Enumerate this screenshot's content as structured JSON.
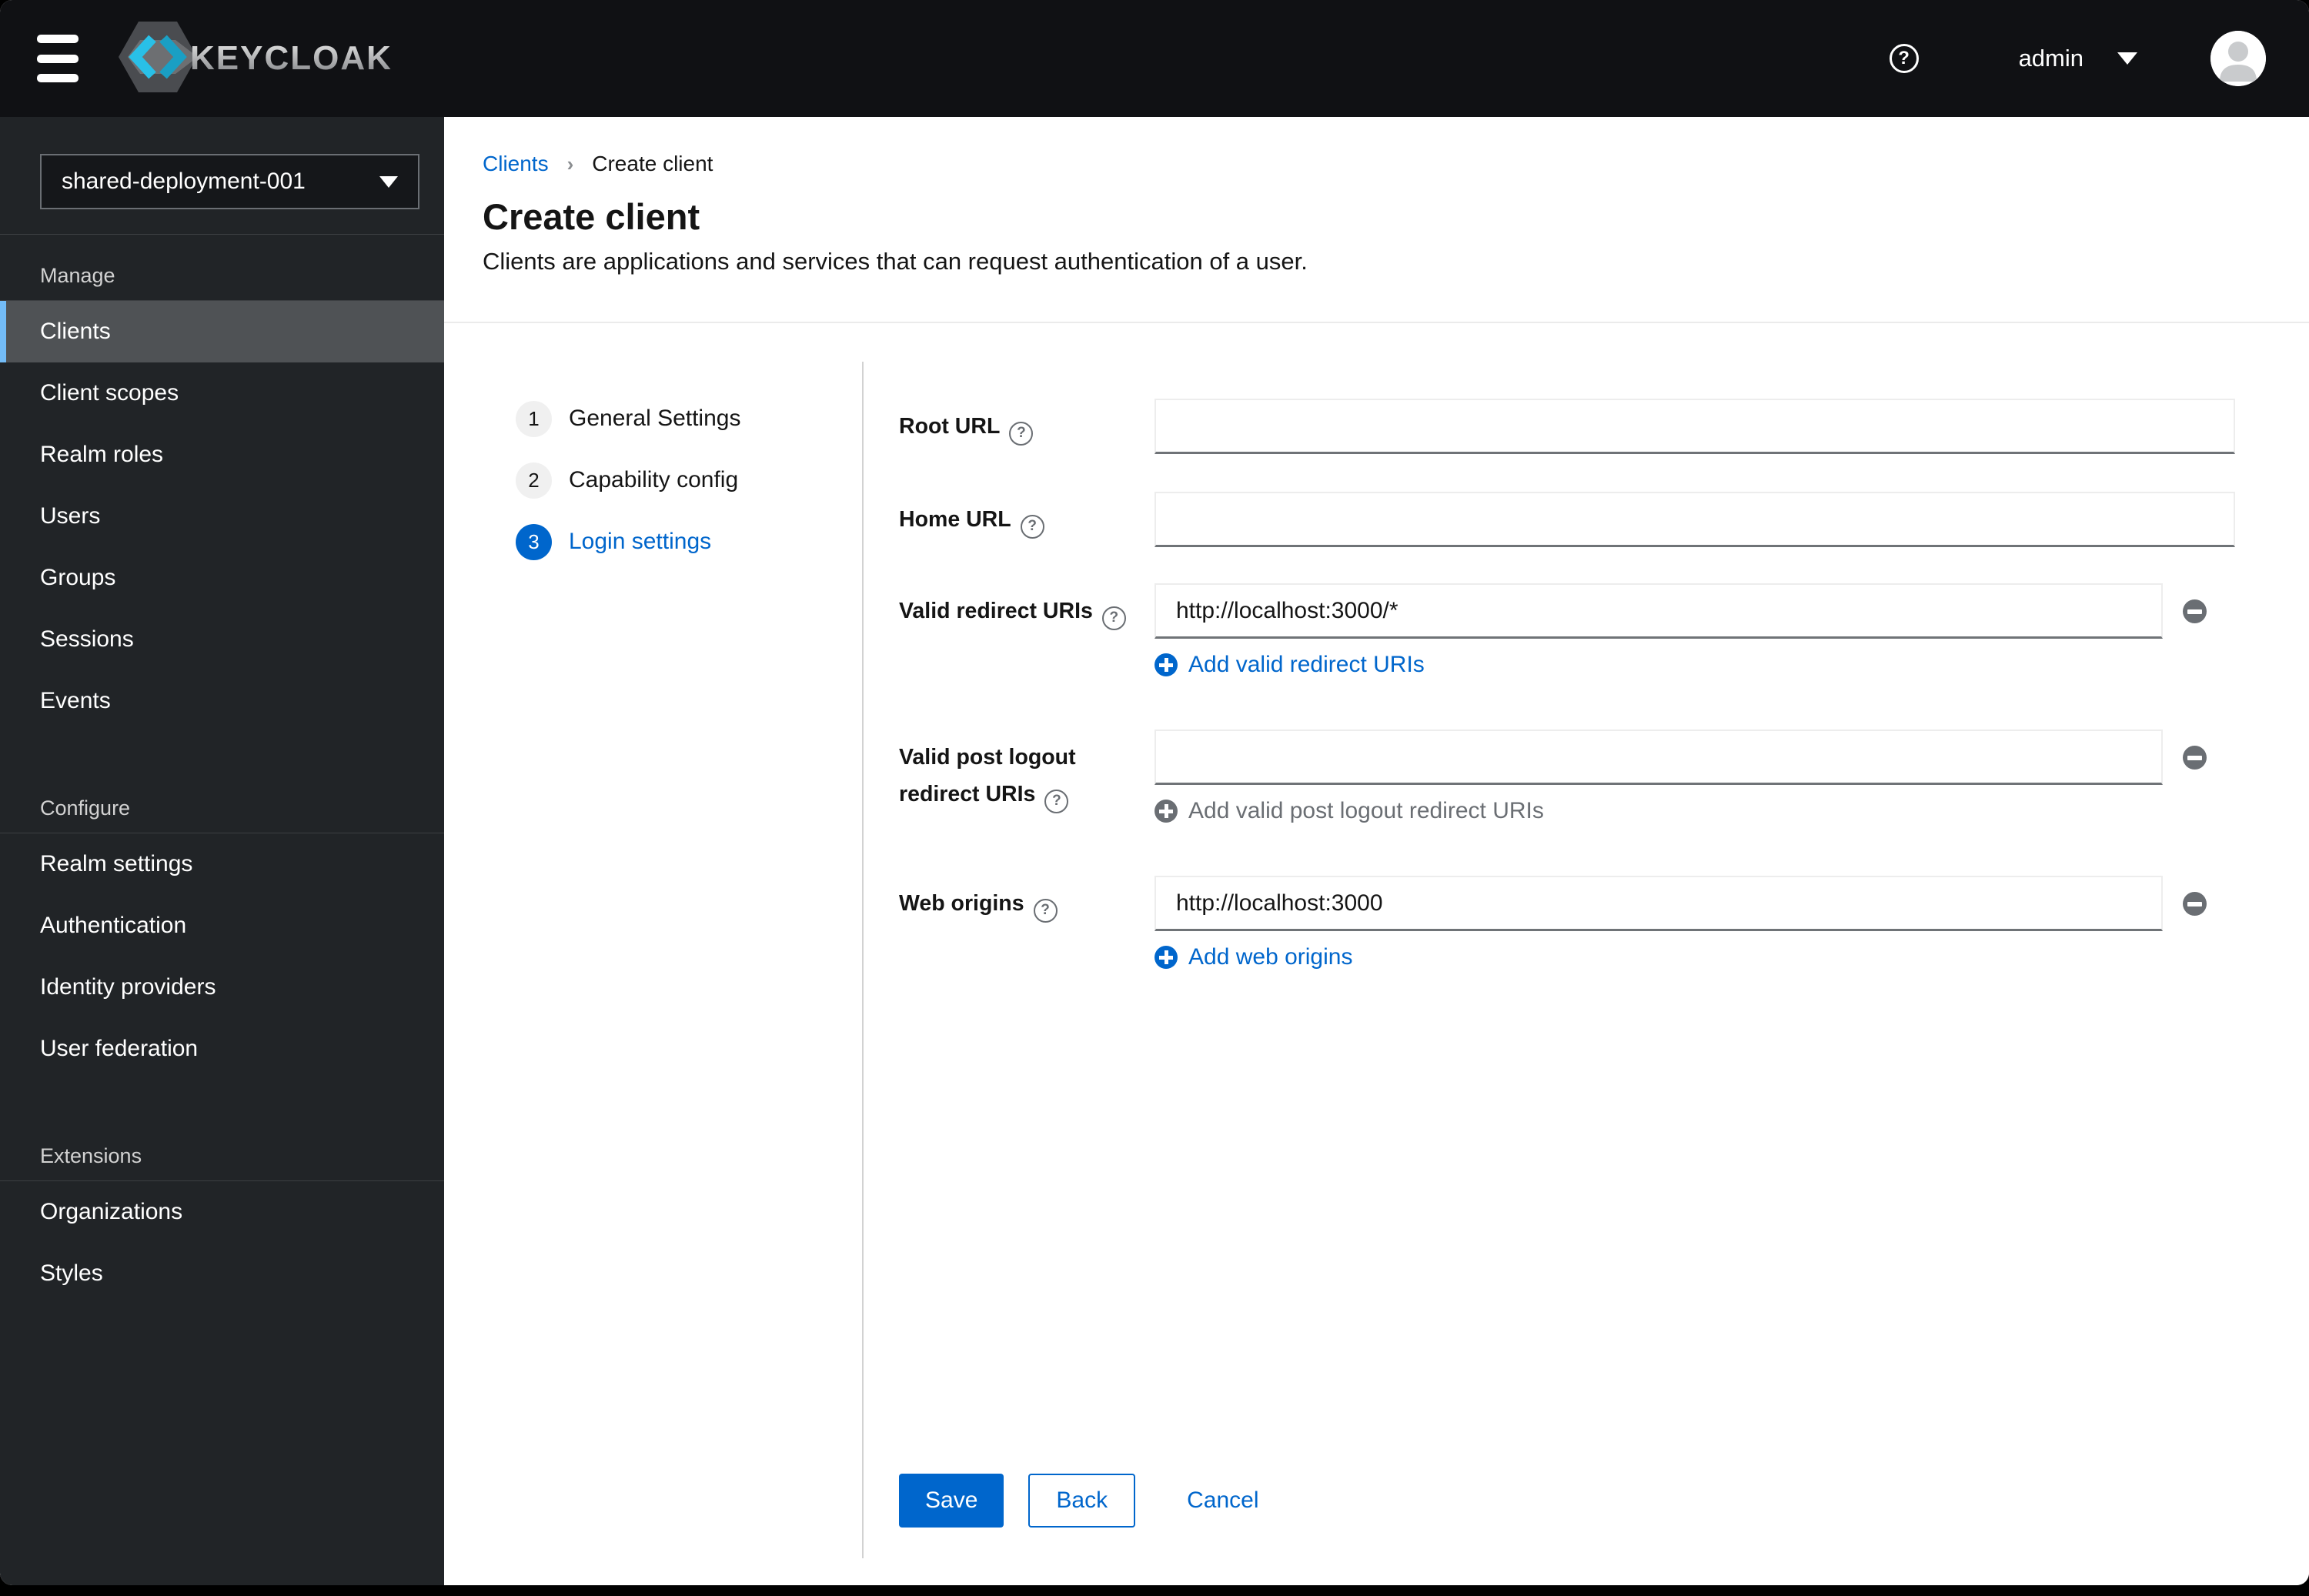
{
  "colors": {
    "accent": "#0066cc",
    "header_bg": "#101114",
    "sidebar_bg": "#212427",
    "active_item_bg": "#4f5255",
    "active_item_accent": "#73bcf7",
    "muted_gray": "#6a6e73",
    "logo_cyan": "#1fb5d8"
  },
  "header": {
    "logo_text": "KEYCLOAK",
    "help_icon": "?",
    "username": "admin"
  },
  "sidebar": {
    "realm": "shared-deployment-001",
    "sections": [
      {
        "title": "Manage",
        "items": [
          {
            "label": "Clients"
          },
          {
            "label": "Client scopes"
          },
          {
            "label": "Realm roles"
          },
          {
            "label": "Users"
          },
          {
            "label": "Groups"
          },
          {
            "label": "Sessions"
          },
          {
            "label": "Events"
          }
        ]
      },
      {
        "title": "Configure",
        "items": [
          {
            "label": "Realm settings"
          },
          {
            "label": "Authentication"
          },
          {
            "label": "Identity providers"
          },
          {
            "label": "User federation"
          }
        ]
      },
      {
        "title": "Extensions",
        "items": [
          {
            "label": "Organizations"
          },
          {
            "label": "Styles"
          }
        ]
      }
    ]
  },
  "breadcrumb": {
    "parent": "Clients",
    "separator": "›",
    "current": "Create client"
  },
  "page": {
    "title": "Create client",
    "subtitle": "Clients are applications and services that can request authentication of a user."
  },
  "wizard": {
    "steps": [
      {
        "number": "1",
        "label": "General Settings"
      },
      {
        "number": "2",
        "label": "Capability config"
      },
      {
        "number": "3",
        "label": "Login settings"
      }
    ]
  },
  "form": {
    "root_url": {
      "label": "Root URL",
      "value": ""
    },
    "home_url": {
      "label": "Home URL",
      "value": ""
    },
    "valid_redirect_uris": {
      "label": "Valid redirect URIs",
      "value": "http://localhost:3000/*",
      "add_label": "Add valid redirect URIs"
    },
    "valid_post_logout": {
      "label_line1": "Valid post logout",
      "label_line2": "redirect URIs",
      "value": "",
      "add_label": "Add valid post logout redirect URIs"
    },
    "web_origins": {
      "label": "Web origins",
      "value": "http://localhost:3000",
      "add_label": "Add web origins"
    }
  },
  "footer": {
    "save": "Save",
    "back": "Back",
    "cancel": "Cancel"
  }
}
